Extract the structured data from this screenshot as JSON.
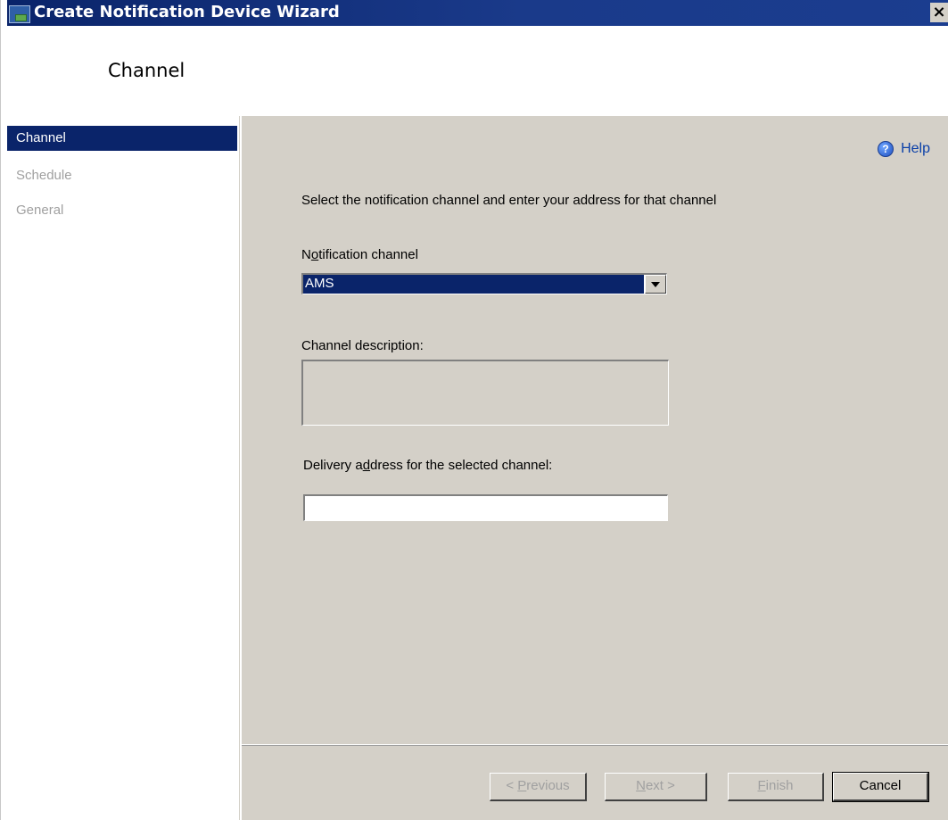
{
  "window": {
    "title": "Create Notification Device Wizard",
    "close_glyph": "×"
  },
  "header": {
    "title": "Channel"
  },
  "sidebar": {
    "items": [
      {
        "label": "Channel",
        "active": true
      },
      {
        "label": "Schedule",
        "active": false
      },
      {
        "label": "General",
        "active": false
      }
    ]
  },
  "content": {
    "help_label": "Help",
    "instruction": "Select the notification channel and enter your address for that channel",
    "notification_channel": {
      "label_pre": "N",
      "label_mnemonic": "o",
      "label_post": "tification channel",
      "selected_value": "AMS"
    },
    "channel_description": {
      "label": "Channel description:",
      "value": ""
    },
    "delivery_address": {
      "label_pre": "Delivery a",
      "label_mnemonic": "d",
      "label_post": "dress for the selected channel:",
      "value": ""
    }
  },
  "footer": {
    "previous": {
      "arrow": "< ",
      "mnemonic": "P",
      "rest": "revious"
    },
    "next": {
      "mnemonic": "N",
      "rest": "ext",
      "arrow": " >"
    },
    "finish": {
      "mnemonic": "F",
      "rest": "inish"
    },
    "cancel": {
      "label": "Cancel"
    }
  },
  "colors": {
    "selection": "#0a246a",
    "dialog_face": "#d4d0c8",
    "disabled_text": "#a0a0a0",
    "link": "#0a3fa8"
  },
  "icons": {
    "app": "wizard-app-icon",
    "help": "help-icon",
    "dropdown": "chevron-down-icon",
    "close": "close-icon"
  }
}
